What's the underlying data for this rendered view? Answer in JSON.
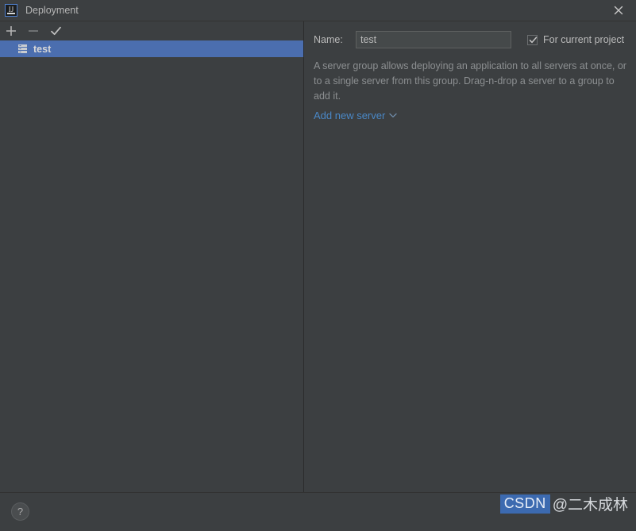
{
  "window": {
    "title": "Deployment",
    "app_icon": "intellij-idea-icon",
    "close_icon": "close-icon"
  },
  "toolbar": {
    "add_label": "+",
    "add_icon": "plus-icon",
    "remove_label": "−",
    "remove_icon": "minus-icon",
    "check_label": "✓",
    "check_icon": "check-icon"
  },
  "tree": {
    "items": [
      {
        "label": "test",
        "icon": "server-group-icon",
        "selected": true
      }
    ]
  },
  "form": {
    "name_label": "Name:",
    "name_value": "test",
    "name_placeholder": "",
    "for_current_project_label": "For current project",
    "for_current_project_checked": true,
    "description": "A server group allows deploying an application to all servers at once, or to a single server from this group. Drag-n-drop a server to a group to add it.",
    "add_new_server_label": "Add new server",
    "add_new_server_chevron": "chevron-down-icon"
  },
  "footer": {
    "help_label": "?",
    "help_icon": "help-icon"
  },
  "watermark": {
    "brand": "CSDN",
    "user": "@二木成林"
  },
  "colors": {
    "background": "#3c3f41",
    "selection": "#4b6eaf",
    "link": "#4a88c7",
    "text": "#bbbbbb",
    "muted_text": "#8c8f91",
    "field_background": "#45494a",
    "border": "#2b2b2b"
  }
}
